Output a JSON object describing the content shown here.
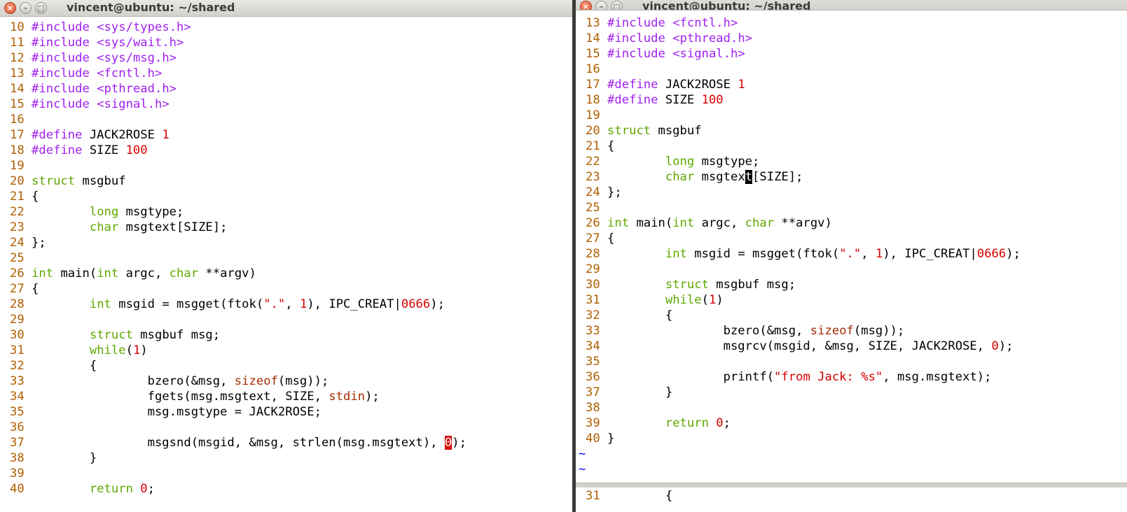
{
  "left_window": {
    "title": "vincent@ubuntu: ~/shared",
    "lines": [
      {
        "n": "10",
        "t": "#include <sys/types.h>"
      },
      {
        "n": "11",
        "t": "#include <sys/wait.h>"
      },
      {
        "n": "12",
        "t": "#include <sys/msg.h>"
      },
      {
        "n": "13",
        "t": "#include <fcntl.h>"
      },
      {
        "n": "14",
        "t": "#include <pthread.h>"
      },
      {
        "n": "15",
        "t": "#include <signal.h>"
      },
      {
        "n": "16",
        "t": ""
      },
      {
        "n": "17",
        "t": "#define JACK2ROSE 1"
      },
      {
        "n": "18",
        "t": "#define SIZE 100"
      },
      {
        "n": "19",
        "t": ""
      },
      {
        "n": "20",
        "t": "struct msgbuf"
      },
      {
        "n": "21",
        "t": "{"
      },
      {
        "n": "22",
        "t": "        long msgtype;"
      },
      {
        "n": "23",
        "t": "        char msgtext[SIZE];"
      },
      {
        "n": "24",
        "t": "};"
      },
      {
        "n": "25",
        "t": ""
      },
      {
        "n": "26",
        "t": "int main(int argc, char **argv)"
      },
      {
        "n": "27",
        "t": "{"
      },
      {
        "n": "28",
        "t": "        int msgid = msgget(ftok(\".\", 1), IPC_CREAT|0666);"
      },
      {
        "n": "29",
        "t": ""
      },
      {
        "n": "30",
        "t": "        struct msgbuf msg;"
      },
      {
        "n": "31",
        "t": "        while(1)"
      },
      {
        "n": "32",
        "t": "        {"
      },
      {
        "n": "33",
        "t": "                bzero(&msg, sizeof(msg));"
      },
      {
        "n": "34",
        "t": "                fgets(msg.msgtext, SIZE, stdin);"
      },
      {
        "n": "35",
        "t": "                msg.msgtype = JACK2ROSE;"
      },
      {
        "n": "36",
        "t": ""
      },
      {
        "n": "37",
        "t": "                msgsnd(msgid, &msg, strlen(msg.msgtext), 0);"
      },
      {
        "n": "38",
        "t": "        }"
      },
      {
        "n": "39",
        "t": ""
      },
      {
        "n": "40",
        "t": "        return 0;"
      }
    ]
  },
  "right_window": {
    "title": "vincent@ubuntu: ~/shared",
    "lines": [
      {
        "n": "13",
        "t": "#include <fcntl.h>"
      },
      {
        "n": "14",
        "t": "#include <pthread.h>"
      },
      {
        "n": "15",
        "t": "#include <signal.h>"
      },
      {
        "n": "16",
        "t": ""
      },
      {
        "n": "17",
        "t": "#define JACK2ROSE 1"
      },
      {
        "n": "18",
        "t": "#define SIZE 100"
      },
      {
        "n": "19",
        "t": ""
      },
      {
        "n": "20",
        "t": "struct msgbuf"
      },
      {
        "n": "21",
        "t": "{"
      },
      {
        "n": "22",
        "t": "        long msgtype;"
      },
      {
        "n": "23",
        "t": "        char msgtext[SIZE];"
      },
      {
        "n": "24",
        "t": "};"
      },
      {
        "n": "25",
        "t": ""
      },
      {
        "n": "26",
        "t": "int main(int argc, char **argv)"
      },
      {
        "n": "27",
        "t": "{"
      },
      {
        "n": "28",
        "t": "        int msgid = msgget(ftok(\".\", 1), IPC_CREAT|0666);"
      },
      {
        "n": "29",
        "t": ""
      },
      {
        "n": "30",
        "t": "        struct msgbuf msg;"
      },
      {
        "n": "31",
        "t": "        while(1)"
      },
      {
        "n": "32",
        "t": "        {"
      },
      {
        "n": "33",
        "t": "                bzero(&msg, sizeof(msg));"
      },
      {
        "n": "34",
        "t": "                msgrcv(msgid, &msg, SIZE, JACK2ROSE, 0);"
      },
      {
        "n": "35",
        "t": ""
      },
      {
        "n": "36",
        "t": "                printf(\"from Jack: %s\", msg.msgtext);"
      },
      {
        "n": "37",
        "t": "        }"
      },
      {
        "n": "38",
        "t": ""
      },
      {
        "n": "39",
        "t": "        return 0;"
      },
      {
        "n": "40",
        "t": "}"
      }
    ],
    "tildes": [
      "~",
      "~"
    ],
    "bottom_line": {
      "n": "31",
      "t": "        {"
    }
  },
  "colors": {
    "line_number": "#af5f00",
    "type_keyword": "#5fa700",
    "preprocessor": "#a020f0",
    "constant": "#d70000",
    "tilde": "#0000ff",
    "close_button": "#e2532c"
  }
}
